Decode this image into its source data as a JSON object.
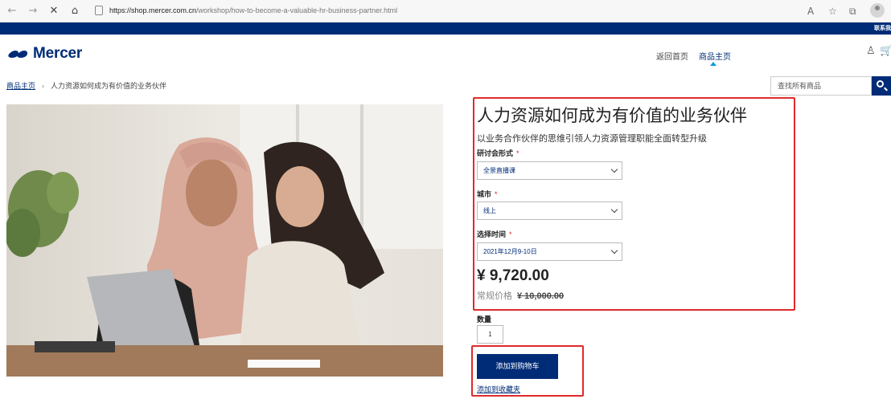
{
  "browser": {
    "url_host": "https://shop.mercer.com.cn",
    "url_path": "/workshop/how-to-become-a-valuable-hr-business-partner.html",
    "icons": [
      "back-icon",
      "forward-icon",
      "close-icon",
      "home-icon",
      "lock-icon",
      "read-aloud-icon",
      "favorites-icon",
      "collections-icon",
      "profile-icon"
    ]
  },
  "top_strip": {
    "contact_label": "联系我"
  },
  "header": {
    "logo_text": "Mercer",
    "nav": [
      {
        "label": "返回首页"
      },
      {
        "label": "商品主页",
        "active": true
      }
    ],
    "icons": [
      "user-icon",
      "cart-icon"
    ]
  },
  "breadcrumb": {
    "home": "商品主页",
    "separator": "›",
    "current": "人力资源如何成为有价值的业务伙伴"
  },
  "search": {
    "placeholder": "查找所有商品"
  },
  "product": {
    "title": "人力资源如何成为有价值的业务伙伴",
    "subtitle": "以业务合作伙伴的思维引领人力资源管理职能全面转型升级",
    "fields": [
      {
        "label": "研讨会形式",
        "required_mark": "*",
        "value": "全景直播课"
      },
      {
        "label": "城市",
        "required_mark": "*",
        "value": "线上"
      },
      {
        "label": "选择时间",
        "required_mark": "*",
        "value": "2021年12月9-10日"
      }
    ],
    "price": "¥ 9,720.00",
    "regular_label": "常规价格",
    "regular_price": "¥ 10,000.00",
    "quantity_label": "数量",
    "quantity_value": "1",
    "add_to_cart": "添加到购物车",
    "wishlist": "添加到收藏夹"
  },
  "colors": {
    "brand_navy": "#002c77",
    "accent_blue": "#009de0",
    "annotation_red": "#e02a2a",
    "required_red": "#d8232a"
  }
}
